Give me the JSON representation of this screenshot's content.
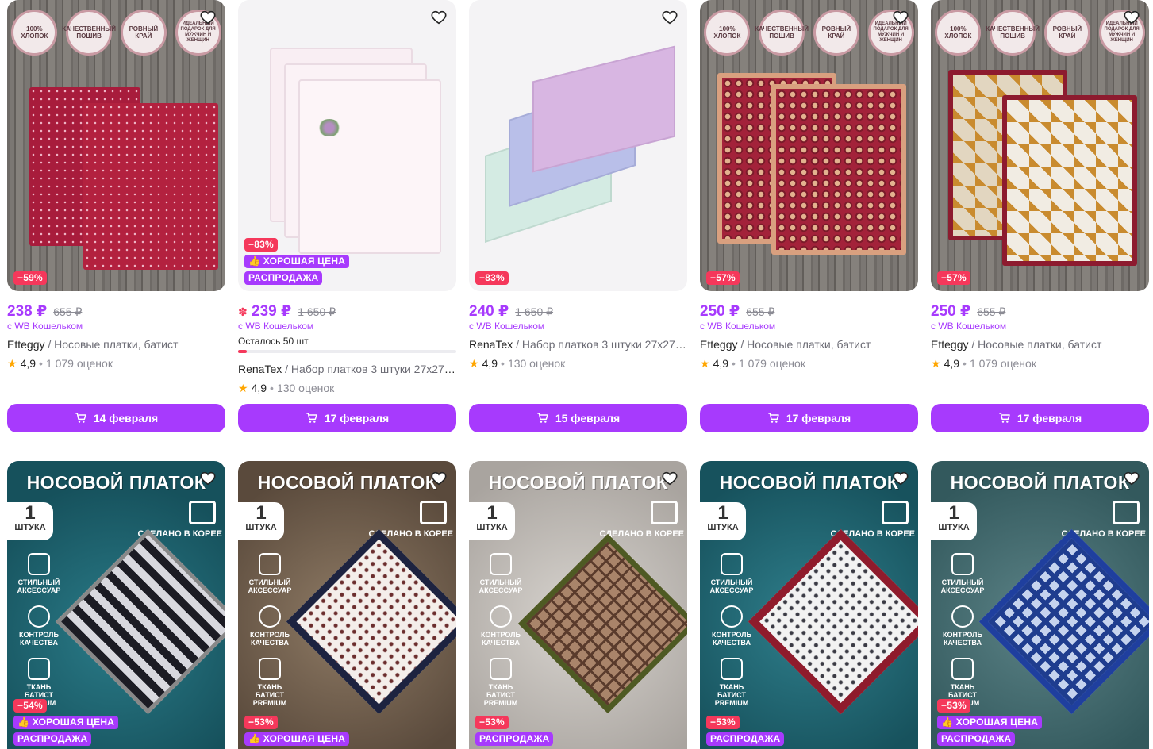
{
  "products_row1": [
    {
      "price": "238 ₽",
      "old_price": "655 ₽",
      "wallet": "с WB Кошельком",
      "brand": "Etteggy",
      "category": "/ Носовые платки, батист",
      "rating": "4,9",
      "reviews": "1 079 оценок",
      "delivery": "14 февраля",
      "discount": "−59%",
      "circles": [
        "100% ХЛОПОК",
        "КАЧЕСТВЕННЫЙ ПОШИВ",
        "РОВНЫЙ КРАЙ",
        "ИДЕАЛЬНЫЙ ПОДАРОК ДЛЯ МУЖЧИН И ЖЕНЩИН"
      ]
    },
    {
      "price": "239 ₽",
      "old_price": "1 650 ₽",
      "wallet": "с WB Кошельком",
      "stock": "Осталось 50 шт",
      "stock_fraction": 0.04,
      "brand": "RenaTex",
      "category": "/ Набор платков 3 штуки 27x27 ...",
      "rating": "4,9",
      "reviews": "130 оценок",
      "delivery": "17 февраля",
      "discount": "−83%",
      "good_price": "ХОРОШАЯ ЦЕНА",
      "sale": "РАСПРОДАЖА"
    },
    {
      "price": "240 ₽",
      "old_price": "1 650 ₽",
      "wallet": "с WB Кошельком",
      "brand": "RenaTex",
      "category": "/ Набор платков 3 штуки 27x27 ...",
      "rating": "4,9",
      "reviews": "130 оценок",
      "delivery": "15 февраля",
      "discount": "−83%"
    },
    {
      "price": "250 ₽",
      "old_price": "655 ₽",
      "wallet": "с WB Кошельком",
      "brand": "Etteggy",
      "category": "/ Носовые платки, батист",
      "rating": "4,9",
      "reviews": "1 079 оценок",
      "delivery": "17 февраля",
      "discount": "−57%",
      "circles": [
        "100% ХЛОПОК",
        "КАЧЕСТВЕННЫЙ ПОШИВ",
        "РОВНЫЙ КРАЙ",
        "ИДЕАЛЬНЫЙ ПОДАРОК ДЛЯ МУЖЧИН И ЖЕНЩИН"
      ]
    },
    {
      "price": "250 ₽",
      "old_price": "655 ₽",
      "wallet": "с WB Кошельком",
      "brand": "Etteggy",
      "category": "/ Носовые платки, батист",
      "rating": "4,9",
      "reviews": "1 079 оценок",
      "delivery": "17 февраля",
      "discount": "−57%",
      "circles": [
        "100% ХЛОПОК",
        "КАЧЕСТВЕННЫЙ ПОШИВ",
        "РОВНЫЙ КРАЙ",
        "ИДЕАЛЬНЫЙ ПОДАРОК ДЛЯ МУЖЧИН И ЖЕНЩИН"
      ]
    }
  ],
  "products_row2": [
    {
      "title": "НОСОВОЙ ПЛАТОК",
      "one": "1",
      "one_sub": "ШТУКА",
      "korea": "СДЕЛАНО В КОРЕЕ",
      "features": [
        "СТИЛЬНЫЙ АКСЕССУАР",
        "КОНТРОЛЬ КАЧЕСТВА",
        "ТКАНЬ БАТИСТ PREMIUM"
      ],
      "discount": "−54%",
      "good_price": "ХОРОШАЯ ЦЕНА",
      "sale": "РАСПРОДАЖА"
    },
    {
      "title": "НОСОВОЙ ПЛАТОК",
      "one": "1",
      "one_sub": "ШТУКА",
      "korea": "СДЕЛАНО В КОРЕЕ",
      "features": [
        "СТИЛЬНЫЙ АКСЕССУАР",
        "КОНТРОЛЬ КАЧЕСТВА",
        "ТКАНЬ БАТИСТ PREMIUM"
      ],
      "discount": "−53%",
      "good_price": "ХОРОШАЯ ЦЕНА"
    },
    {
      "title": "НОСОВОЙ ПЛАТОК",
      "one": "1",
      "one_sub": "ШТУКА",
      "korea": "СДЕЛАНО В КОРЕЕ",
      "features": [
        "СТИЛЬНЫЙ АКСЕССУАР",
        "КОНТРОЛЬ КАЧЕСТВА",
        "ТКАНЬ БАТИСТ PREMIUM"
      ],
      "discount": "−53%",
      "sale": "РАСПРОДАЖА"
    },
    {
      "title": "НОСОВОЙ ПЛАТОК",
      "one": "1",
      "one_sub": "ШТУКА",
      "korea": "СДЕЛАНО В КОРЕЕ",
      "features": [
        "СТИЛЬНЫЙ АКСЕССУАР",
        "КОНТРОЛЬ КАЧЕСТВА",
        "ТКАНЬ БАТИСТ PREMIUM"
      ],
      "discount": "−53%",
      "sale": "РАСПРОДАЖА"
    },
    {
      "title": "НОСОВОЙ ПЛАТОК",
      "one": "1",
      "one_sub": "ШТУКА",
      "korea": "СДЕЛАНО В КОРЕЕ",
      "features": [
        "СТИЛЬНЫЙ АКСЕССУАР",
        "КОНТРОЛЬ КАЧЕСТВА",
        "ТКАНЬ БАТИСТ PREMIUM"
      ],
      "discount": "−53%",
      "good_price": "ХОРОШАЯ ЦЕНА",
      "sale": "РАСПРОДАЖА"
    }
  ],
  "colors": {
    "accent": "#a73afd",
    "discount": "#f5385b",
    "star": "#ffa600"
  }
}
